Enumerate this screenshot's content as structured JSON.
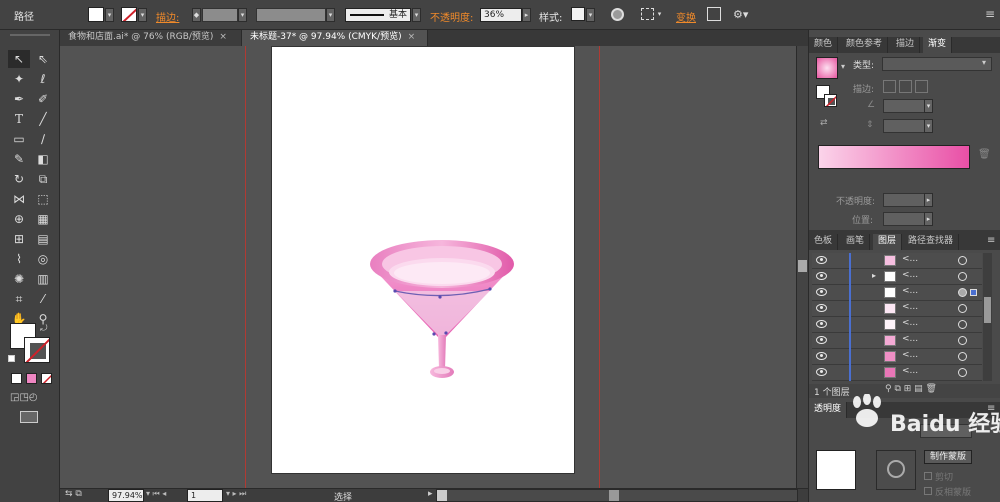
{
  "control_bar": {
    "object_type": "路径",
    "stroke_label": "描边:",
    "stroke_profile": "基本",
    "opacity_label": "不透明度:",
    "opacity_value": "36%",
    "style_label": "样式:",
    "transform_label": "变换"
  },
  "doc_tabs": [
    {
      "label": "食物和店面.ai* @ 76% (RGB/预览)",
      "close": "×"
    },
    {
      "label": "未标题-37* @ 97.94% (CMYK/预览)",
      "close": "×"
    }
  ],
  "gradient_panel": {
    "tabs": [
      "颜色",
      "颜色参考",
      "描边",
      "渐变"
    ],
    "type_label": "类型:",
    "stroke_label": "描边:",
    "opacity_label": "不透明度:",
    "position_label": "位置:",
    "colors": {
      "start": "#fbd4ea",
      "end": "#e94fa6"
    }
  },
  "layers_panel": {
    "tabs": [
      "色板",
      "画笔",
      "图层",
      "路径查找器"
    ],
    "row_name": "<...",
    "row_count": 8,
    "footer_text": "1 个图层"
  },
  "transparency_panel": {
    "tab": "透明度",
    "make_mask_button": "制作蒙版",
    "clip_label": "剪切",
    "invert_mask_label": "反相蒙版"
  },
  "watermark": {
    "text": "Baidu 经验"
  },
  "status_bar": {
    "zoom": "97.94%",
    "artboard": "1",
    "tool_label": "选择"
  },
  "colors": {
    "app_bg": "#535353",
    "guide": "#c0392b",
    "glass_pink": "#f3a0cf",
    "glass_deep": "#e35aa9"
  }
}
